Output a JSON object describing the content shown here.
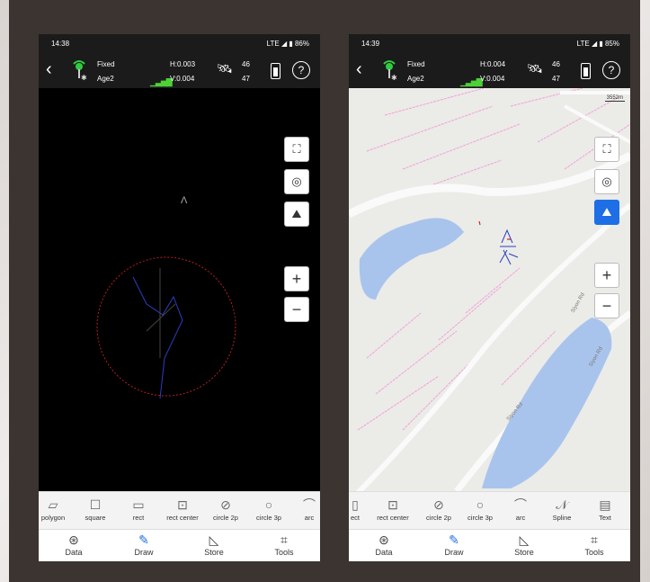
{
  "colors": {
    "accent": "#1e6fe6",
    "gps_green": "#2ecc40",
    "signal": "#4cd137",
    "water": "#a9c4ec",
    "road_pink": "#f3a0d8"
  },
  "left": {
    "status": {
      "time": "14:38",
      "network": "LTE",
      "battery": "86%"
    },
    "gnss": {
      "solution": "Fixed",
      "age": "Age2",
      "h": "H:0.003",
      "v": "V:0.004",
      "sats_used": "46",
      "sats_visible": "47"
    },
    "draw_tools": [
      "polygon",
      "square",
      "rect",
      "rect center",
      "circle 2p",
      "circle 3p",
      "arc"
    ],
    "nav": [
      "Data",
      "Draw",
      "Store",
      "Tools"
    ],
    "active_nav": "Draw"
  },
  "right": {
    "status": {
      "time": "14:39",
      "network": "LTE",
      "battery": "85%"
    },
    "gnss": {
      "solution": "Fixed",
      "age": "Age2",
      "h": "H:0.004",
      "v": "V:0.004",
      "sats_used": "46",
      "sats_visible": "47"
    },
    "scale": "3552m",
    "roads": [
      "Siyon Rd",
      "Siyon Rd",
      "Siyon Rd"
    ],
    "draw_tools": [
      "ect",
      "rect center",
      "circle 2p",
      "circle 3p",
      "arc",
      "Spline",
      "Text"
    ],
    "nav": [
      "Data",
      "Draw",
      "Store",
      "Tools"
    ],
    "active_nav": "Draw"
  },
  "icons": {
    "back": "‹",
    "help": "?",
    "satellite": "🛰",
    "zoom_in": "+",
    "zoom_out": "−",
    "full_extent": "⛶",
    "locate": "◎",
    "map_layer": "⛰"
  }
}
